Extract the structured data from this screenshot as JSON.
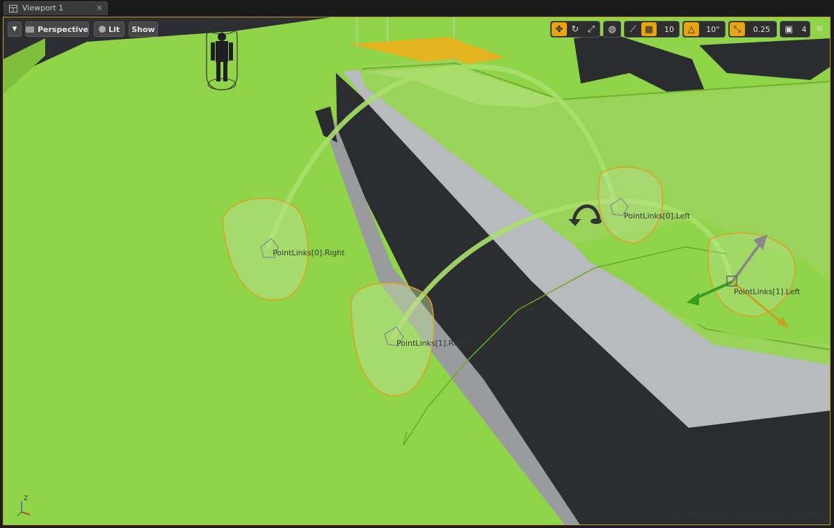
{
  "tab": {
    "title": "Viewport 1",
    "close_glyph": "×"
  },
  "toolbar": {
    "perspective_label": "Perspective",
    "lit_label": "Lit",
    "show_label": "Show",
    "grid_snap_value": "10",
    "rotation_snap_value": "10°",
    "scale_snap_value": "0.25",
    "camera_speed_value": "4"
  },
  "scene_labels": {
    "link0_right": "PointLinks[0].Right",
    "link0_left": "PointLinks[0].Left",
    "link1_right": "PointLinks[1].Right",
    "link1_left": "PointLinks[1].Left"
  },
  "status": {
    "level_text": "Level:  NavigationExampleMap (Persistent)"
  },
  "gizmo": {
    "z_label": "Z"
  },
  "colors": {
    "nav_green": "#8fd449",
    "accent_orange": "#e7a60f",
    "selection_orange": "#e0a020",
    "dark_wall": "#24262a",
    "ramp_gray": "#b8bbbe"
  },
  "icons": [
    "viewport-menu-icon",
    "translate-icon",
    "rotate-icon",
    "scale-icon",
    "world-icon",
    "surface-snap-icon",
    "grid-icon",
    "rotation-snap-icon",
    "scale-snap-icon",
    "camera-speed-icon",
    "maximize-icon"
  ]
}
